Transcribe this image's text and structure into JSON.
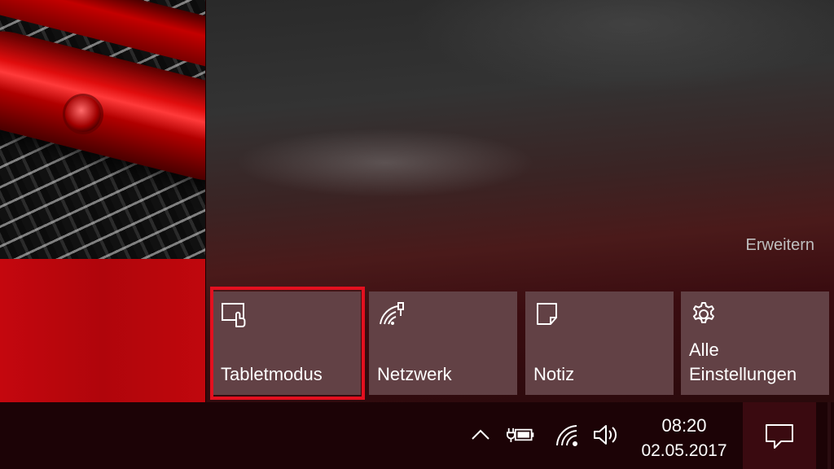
{
  "action_center": {
    "expand_label": "Erweitern",
    "tiles": [
      {
        "label": "Tabletmodus",
        "icon": "tablet-mode-icon"
      },
      {
        "label": "Netzwerk",
        "icon": "network-icon"
      },
      {
        "label": "Notiz",
        "icon": "note-icon"
      },
      {
        "label": "Alle\nEinstellungen",
        "icon": "gear-icon"
      }
    ],
    "highlight_color": "#e3101f",
    "tile_color": "#624145"
  },
  "taskbar": {
    "time": "08:20",
    "date": "02.05.2017",
    "tray_icons": [
      "chevron-up-icon",
      "battery-charging-icon",
      "wifi-icon",
      "volume-icon"
    ],
    "notification_icon": "action-center-icon"
  }
}
